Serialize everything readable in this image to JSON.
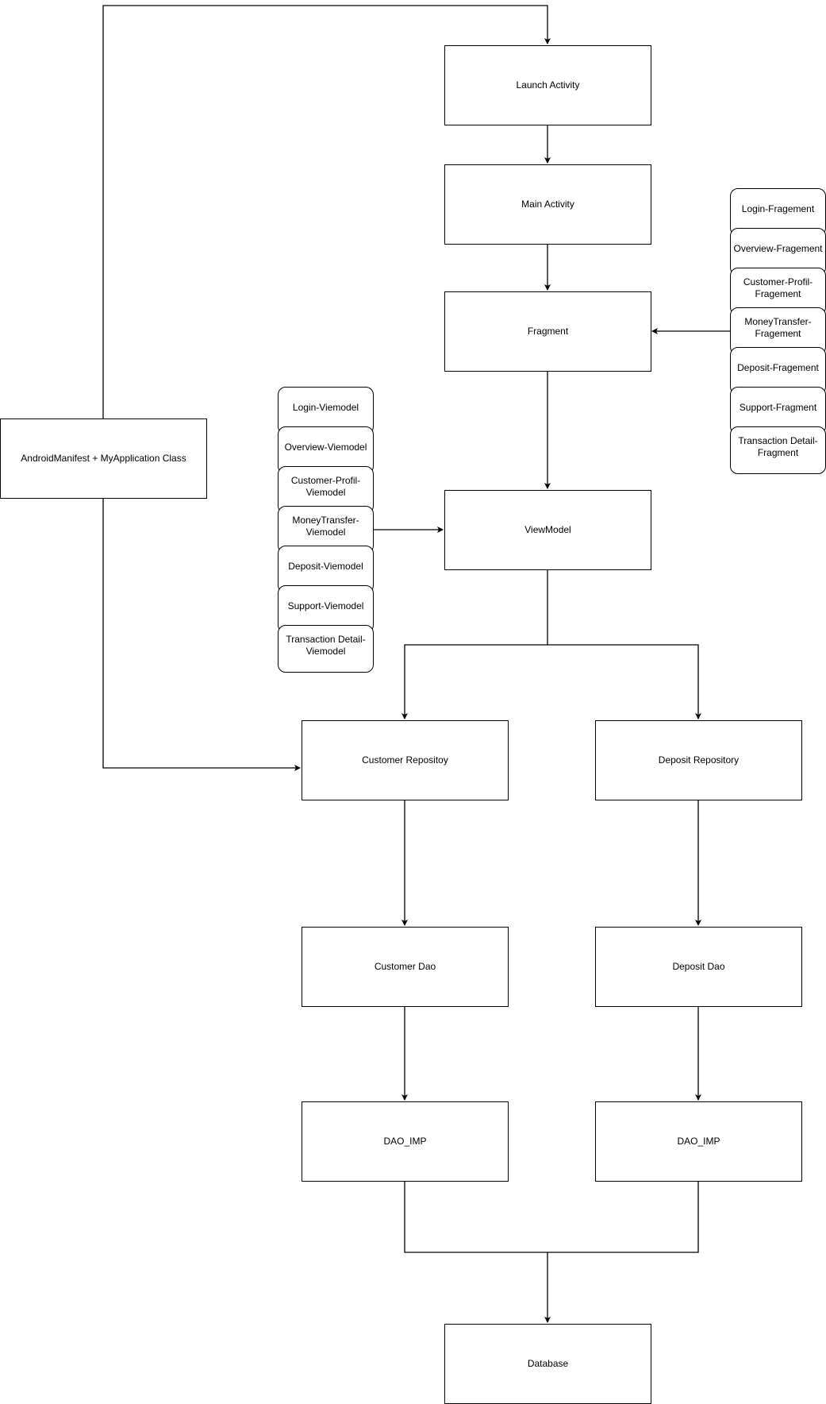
{
  "nodes": {
    "launch_activity": "Launch Activity",
    "main_activity": "Main Activity",
    "fragment": "Fragment",
    "viewmodel": "ViewModel",
    "android_manifest": "AndroidManifest + MyApplication Class",
    "customer_repository": "Customer Repositoy",
    "deposit_repository": "Deposit Repository",
    "customer_dao": "Customer Dao",
    "deposit_dao": "Deposit Dao",
    "customer_dao_imp": "DAO_IMP",
    "deposit_dao_imp": "DAO_IMP",
    "database": "Database"
  },
  "viewmodel_stack": [
    "Login-Viemodel",
    "Overview-Viemodel",
    "Customer-Profil-Viemodel",
    "MoneyTransfer-Viemodel",
    "Deposit-Viemodel",
    "Support-Viemodel",
    "Transaction Detail-Viemodel"
  ],
  "fragment_stack": [
    "Login-Fragement",
    "Overview-Fragement",
    "Customer-Profil-Fragement",
    "MoneyTransfer-Fragement",
    "Deposit-Fragement",
    "Support-Fragment",
    "Transaction Detail-Fragment"
  ],
  "edges": [
    {
      "from": "android_manifest",
      "to": "launch_activity"
    },
    {
      "from": "launch_activity",
      "to": "main_activity"
    },
    {
      "from": "main_activity",
      "to": "fragment"
    },
    {
      "from": "fragment_stack",
      "to": "fragment"
    },
    {
      "from": "fragment",
      "to": "viewmodel"
    },
    {
      "from": "viewmodel_stack",
      "to": "viewmodel"
    },
    {
      "from": "viewmodel",
      "to": "customer_repository"
    },
    {
      "from": "viewmodel",
      "to": "deposit_repository"
    },
    {
      "from": "android_manifest",
      "to": "customer_repository"
    },
    {
      "from": "customer_repository",
      "to": "customer_dao"
    },
    {
      "from": "deposit_repository",
      "to": "deposit_dao"
    },
    {
      "from": "customer_dao",
      "to": "customer_dao_imp"
    },
    {
      "from": "deposit_dao",
      "to": "deposit_dao_imp"
    },
    {
      "from": "customer_dao_imp",
      "to": "database"
    },
    {
      "from": "deposit_dao_imp",
      "to": "database"
    }
  ]
}
